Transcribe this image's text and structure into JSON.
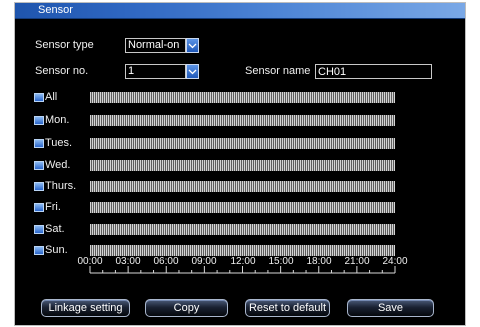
{
  "window": {
    "title": "Sensor"
  },
  "form": {
    "sensor_type_label": "Sensor type",
    "sensor_type_value": "Normal-on",
    "sensor_no_label": "Sensor no.",
    "sensor_no_value": "1",
    "sensor_name_label": "Sensor name",
    "sensor_name_value": "CH01"
  },
  "schedule": {
    "days": [
      {
        "label": "All"
      },
      {
        "label": "Mon."
      },
      {
        "label": "Tues."
      },
      {
        "label": "Wed."
      },
      {
        "label": "Thurs."
      },
      {
        "label": "Fri."
      },
      {
        "label": "Sat."
      },
      {
        "label": "Sun."
      }
    ],
    "time_labels": [
      "00:00",
      "03:00",
      "06:00",
      "09:00",
      "12:00",
      "15:00",
      "18:00",
      "21:00",
      "24:00"
    ]
  },
  "buttons": {
    "linkage": "Linkage setting",
    "copy": "Copy",
    "reset": "Reset to default",
    "save": "Save"
  },
  "icons": {
    "dropdown": "chevron-down-icon",
    "checkbox": "checkbox-icon"
  },
  "colors": {
    "background": "#000000",
    "title_bar": "#2f67c2",
    "checkbox": "#2a66cc",
    "text": "#ffffff"
  }
}
